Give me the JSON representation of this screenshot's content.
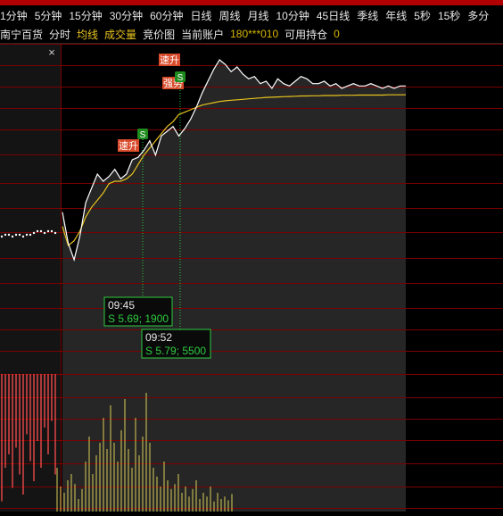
{
  "tabs": [
    "1分钟",
    "5分钟",
    "15分钟",
    "30分钟",
    "60分钟",
    "日线",
    "周线",
    "月线",
    "10分钟",
    "45日线",
    "季线",
    "年线",
    "5秒",
    "15秒",
    "多分"
  ],
  "info": {
    "stock_name": "南宁百货",
    "mode": "分时",
    "avg_line": "均线",
    "volume": "成交量",
    "auction": "竞价图",
    "account_label": "当前账户",
    "account_value": "180***010",
    "hold_label": "可用持仓",
    "hold_value": "0"
  },
  "close_glyph": "×",
  "colors": {
    "background": "#000000",
    "grid": "#7a0000",
    "price_line": "#ffffff",
    "avg_line": "#e8c31e",
    "sell_marker": "#1e8c1e",
    "signal_tag": "#d94a2a",
    "tooltip_border": "#2ecc40",
    "tooltip_text": "#2ecc40",
    "pre_volume": "#ff4d4d",
    "volume": "#d9cf57"
  },
  "tags": {
    "speed_up_1": "速升",
    "speed_up_2": "速升",
    "strong": "强势",
    "sell_1": "S",
    "sell_2": "S"
  },
  "tooltip1": {
    "time": "09:45",
    "detail": "S 5.69; 1900"
  },
  "tooltip2": {
    "time": "09:52",
    "detail": "S 5.79; 5500"
  },
  "chart_data": {
    "type": "line",
    "price_series": [
      0.58,
      0.45,
      0.38,
      0.48,
      0.62,
      0.68,
      0.74,
      0.71,
      0.73,
      0.76,
      0.72,
      0.74,
      0.8,
      0.81,
      0.84,
      0.88,
      0.82,
      0.9,
      0.92,
      0.94,
      0.9,
      0.93,
      0.97,
      1.02,
      1.08,
      1.13,
      1.18,
      1.22,
      1.2,
      1.17,
      1.19,
      1.16,
      1.14,
      1.15,
      1.12,
      1.13,
      1.1,
      1.14,
      1.12,
      1.11,
      1.13,
      1.15,
      1.14,
      1.12,
      1.12,
      1.13,
      1.11,
      1.12,
      1.1,
      1.11,
      1.12,
      1.11,
      1.11,
      1.12,
      1.11,
      1.1,
      1.11,
      1.1,
      1.11,
      1.11
    ],
    "avg_series": [
      0.52,
      0.44,
      0.46,
      0.5,
      0.56,
      0.6,
      0.63,
      0.66,
      0.7,
      0.71,
      0.71,
      0.72,
      0.74,
      0.78,
      0.82,
      0.85,
      0.88,
      0.91,
      0.94,
      0.96,
      0.99,
      1.0,
      1.01,
      1.02,
      1.03,
      1.035,
      1.04,
      1.045,
      1.048,
      1.05,
      1.052,
      1.054,
      1.056,
      1.058,
      1.06,
      1.062,
      1.063,
      1.064,
      1.065,
      1.066,
      1.067,
      1.068,
      1.068,
      1.069,
      1.069,
      1.07,
      1.07,
      1.07,
      1.071,
      1.071,
      1.071,
      1.072,
      1.072,
      1.072,
      1.072,
      1.072,
      1.073,
      1.073,
      1.073,
      1.073
    ],
    "volume_series": [
      0.35,
      0.2,
      0.15,
      0.25,
      0.3,
      0.22,
      0.1,
      0.18,
      0.4,
      0.6,
      0.3,
      0.45,
      0.55,
      0.75,
      0.5,
      0.85,
      0.55,
      0.4,
      0.65,
      0.9,
      0.5,
      0.35,
      0.75,
      0.45,
      0.6,
      0.95,
      0.55,
      0.35,
      0.28,
      0.2,
      0.4,
      0.25,
      0.18,
      0.22,
      0.3,
      0.15,
      0.2,
      0.12,
      0.18,
      0.25,
      0.1,
      0.15,
      0.12,
      0.2,
      0.08,
      0.15,
      0.1,
      0.12,
      0.09,
      0.14
    ],
    "pre_volume_series": [
      0.95,
      0.7,
      0.6,
      0.85,
      0.55,
      0.75,
      0.9,
      0.45,
      0.65,
      0.8,
      0.5,
      0.7,
      0.4,
      0.6,
      0.35,
      0.75
    ],
    "grid": true
  }
}
